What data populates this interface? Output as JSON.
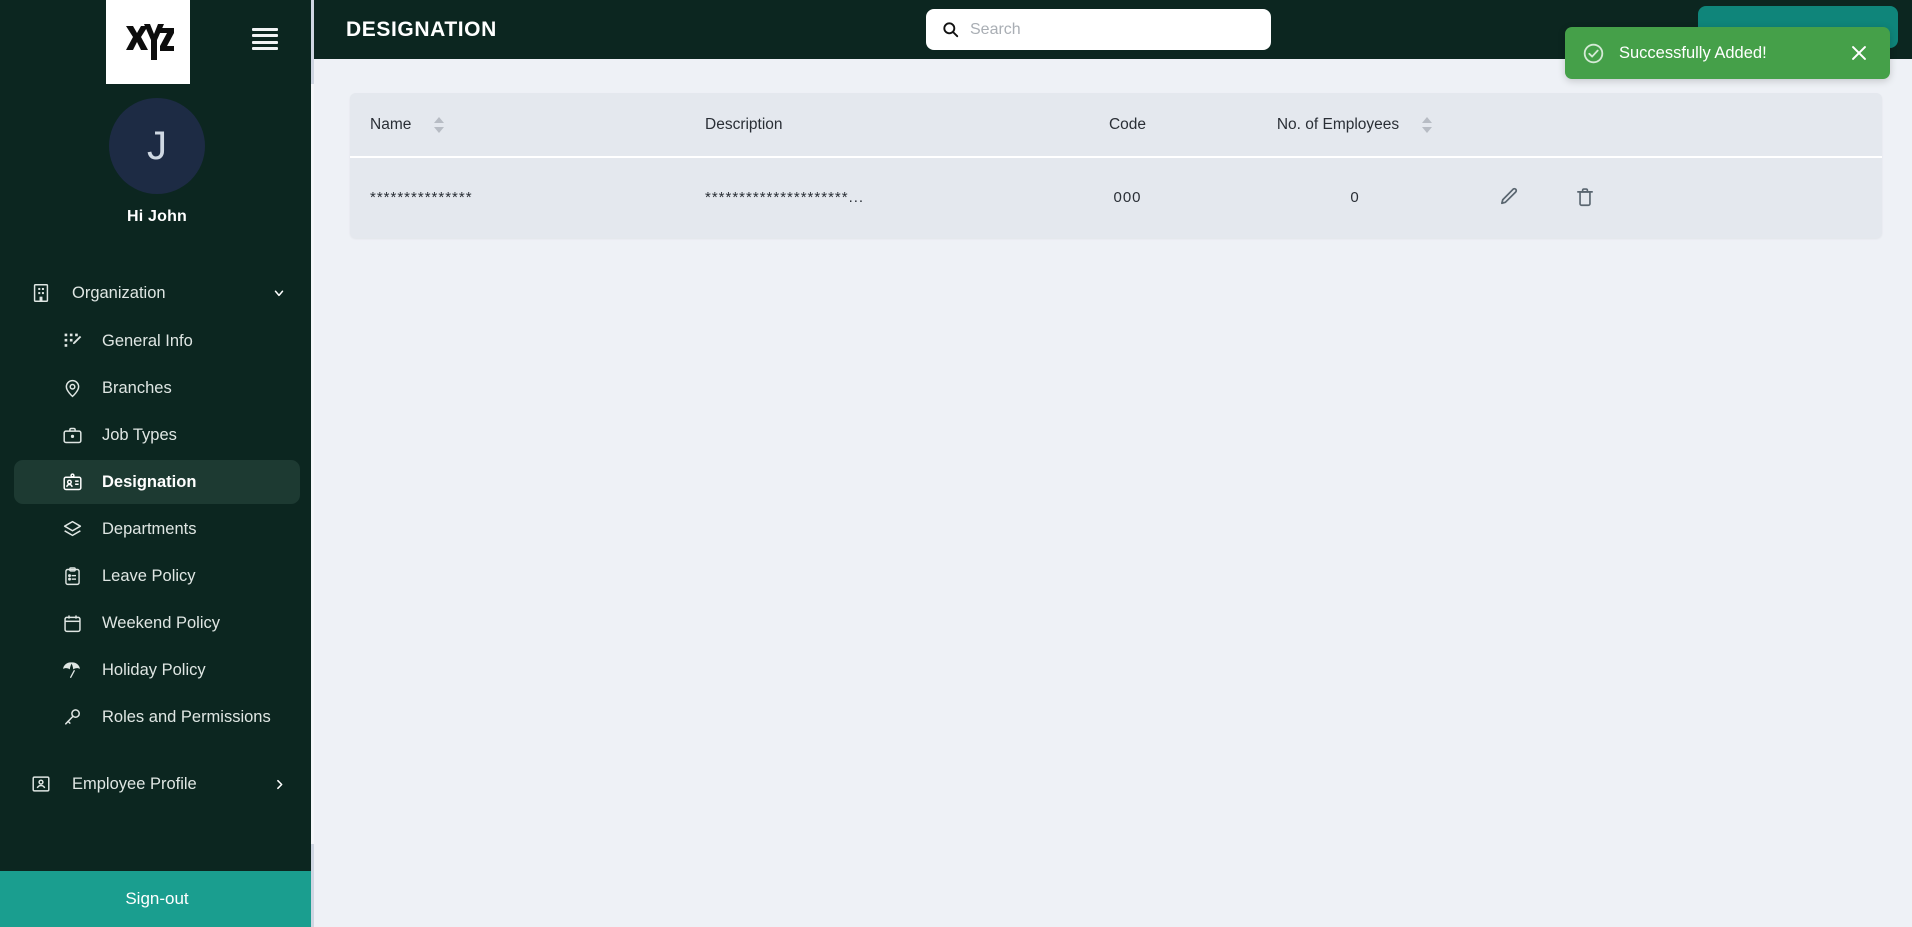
{
  "brand": {
    "logo_text": "XYZ",
    "menu_icon": "hamburger-icon"
  },
  "user": {
    "avatar_initial": "J",
    "greeting": "Hi John"
  },
  "sidebar": {
    "group": {
      "label": "Organization",
      "icon": "building-icon",
      "chevron": "chevron-down-icon"
    },
    "items": [
      {
        "label": "General Info",
        "icon": "grid-edit-icon"
      },
      {
        "label": "Branches",
        "icon": "location-pin-icon"
      },
      {
        "label": "Job Types",
        "icon": "briefcase-icon"
      },
      {
        "label": "Designation",
        "icon": "id-badge-icon",
        "active": true
      },
      {
        "label": "Departments",
        "icon": "layers-icon"
      },
      {
        "label": "Leave Policy",
        "icon": "clipboard-list-icon"
      },
      {
        "label": "Weekend Policy",
        "icon": "calendar-icon"
      },
      {
        "label": "Holiday Policy",
        "icon": "beach-umbrella-icon"
      },
      {
        "label": "Roles and Permissions",
        "icon": "key-icon"
      }
    ],
    "employee_profile": {
      "label": "Employee Profile",
      "icon": "user-card-icon",
      "chevron": "chevron-right-icon"
    },
    "signout": {
      "label": "Sign-out"
    }
  },
  "header": {
    "title": "DESIGNATION",
    "search": {
      "placeholder": "Search",
      "value": "",
      "icon": "search-icon"
    },
    "add_button_label": ""
  },
  "table": {
    "columns": [
      {
        "label": "Name",
        "sortable": true
      },
      {
        "label": "Description",
        "sortable": false
      },
      {
        "label": "Code",
        "sortable": false
      },
      {
        "label": "No. of Employees",
        "sortable": true
      },
      {
        "label": "",
        "sortable": false
      }
    ],
    "rows": [
      {
        "name": "***************",
        "description": "*********************...",
        "code": "000",
        "employees": "0",
        "edit_icon": "pencil-icon",
        "delete_icon": "trash-icon"
      }
    ]
  },
  "toast": {
    "message": "Successfully Added!",
    "icon": "check-circle-icon",
    "close_icon": "close-icon",
    "color": "#45a049"
  },
  "colors": {
    "sidebar_bg": "#0c2620",
    "sidebar_active": "#1d3a32",
    "accent_teal": "#1a9e8f",
    "main_bg": "#eef1f6",
    "card_bg": "#e4e8ee",
    "toast_green": "#45a049"
  }
}
